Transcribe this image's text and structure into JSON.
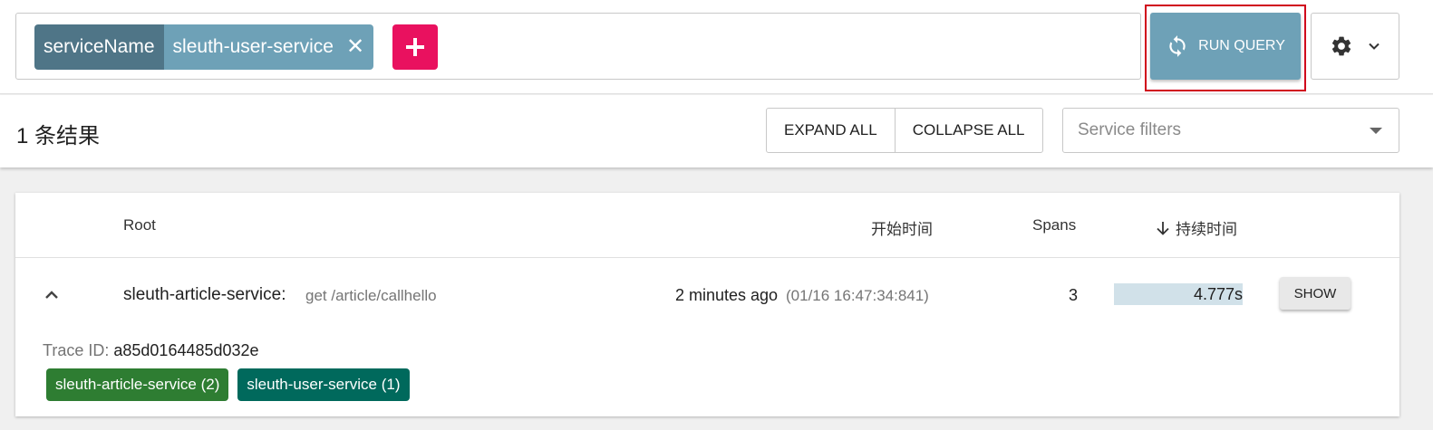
{
  "search": {
    "chip_key": "serviceName",
    "chip_value": "sleuth-user-service",
    "remove_icon": "close-icon",
    "add_icon": "plus-icon"
  },
  "toolbar": {
    "run_query_label": "RUN QUERY",
    "run_query_icon": "sync-icon",
    "settings_icon": "gear-icon"
  },
  "results": {
    "count_label": "1 条结果",
    "expand_all": "EXPAND ALL",
    "collapse_all": "COLLAPSE ALL",
    "service_filter_placeholder": "Service filters"
  },
  "table": {
    "headers": {
      "root": "Root",
      "start_time": "开始时间",
      "spans": "Spans",
      "duration": "持续时间"
    },
    "rows": [
      {
        "service": "sleuth-article-service:",
        "operation": "get /article/callhello",
        "relative_time": "2 minutes ago",
        "absolute_time": "(01/16 16:47:34:841)",
        "spans": "3",
        "duration": "4.777s",
        "duration_fraction": 1.0,
        "show_label": "SHOW",
        "trace_id_label": "Trace ID:",
        "trace_id": "a85d0164485d032e",
        "service_tags": [
          {
            "label": "sleuth-article-service (2)",
            "color": "#2e7d32"
          },
          {
            "label": "sleuth-user-service (1)",
            "color": "#00695c"
          }
        ]
      }
    ]
  },
  "colors": {
    "accent": "#6ea1b7",
    "chip_key_bg": "#4f7587",
    "add_button": "#e9115f",
    "highlight_frame": "#d0021b"
  }
}
